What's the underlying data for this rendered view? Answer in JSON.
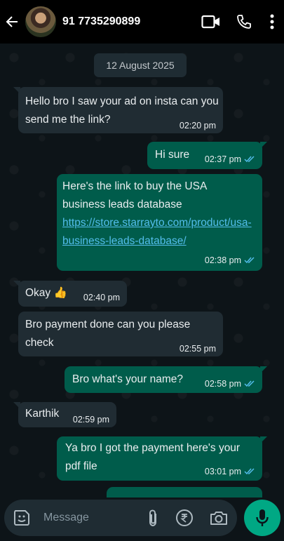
{
  "header": {
    "contact_name": "91 7735290899",
    "icons": [
      "back-arrow-icon",
      "video-call-icon",
      "voice-call-icon",
      "more-options-icon"
    ]
  },
  "chat": {
    "date_label": "12 August 2025",
    "messages": [
      {
        "direction": "in",
        "text": "Hello bro I saw your ad on insta can you send me the link?",
        "time": "02:20 pm"
      },
      {
        "direction": "out",
        "text": "Hi sure",
        "time": "02:37 pm",
        "status": "read"
      },
      {
        "direction": "out",
        "text": " Here's the link to buy the USA business leads database",
        "link": "https://store.starrayto.com/product/usa-business-leads-database/",
        "time": "02:38 pm",
        "status": "read"
      },
      {
        "direction": "in",
        "text": "Okay 👍",
        "time": "02:40 pm"
      },
      {
        "direction": "in",
        "text": "Bro payment done can you please check",
        "time": "02:55 pm"
      },
      {
        "direction": "out",
        "text": "Bro what's your name?",
        "time": "02:58 pm",
        "status": "read"
      },
      {
        "direction": "in",
        "text": "Karthik",
        "time": "02:59 pm"
      },
      {
        "direction": "out",
        "text": "Ya bro I got the payment here's your pdf file",
        "time": "03:01 pm",
        "status": "read"
      }
    ]
  },
  "composer": {
    "placeholder": "Message",
    "icons": [
      "sticker-icon",
      "attach-icon",
      "payment-icon",
      "camera-icon",
      "mic-icon"
    ]
  },
  "colors": {
    "header_bg": "#000000",
    "chat_bg": "#0b141a",
    "incoming_bubble": "#202c33",
    "outgoing_bubble": "#005c4b",
    "link": "#53bdeb",
    "read_ticks": "#53bdeb",
    "mic_button": "#00a884"
  }
}
